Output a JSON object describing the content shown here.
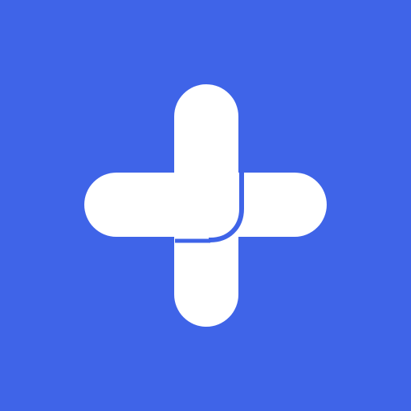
{
  "app": {
    "icon_name": "plus-logo-icon"
  },
  "colors": {
    "background": "#3F64E8",
    "foreground": "#FFFFFF"
  }
}
